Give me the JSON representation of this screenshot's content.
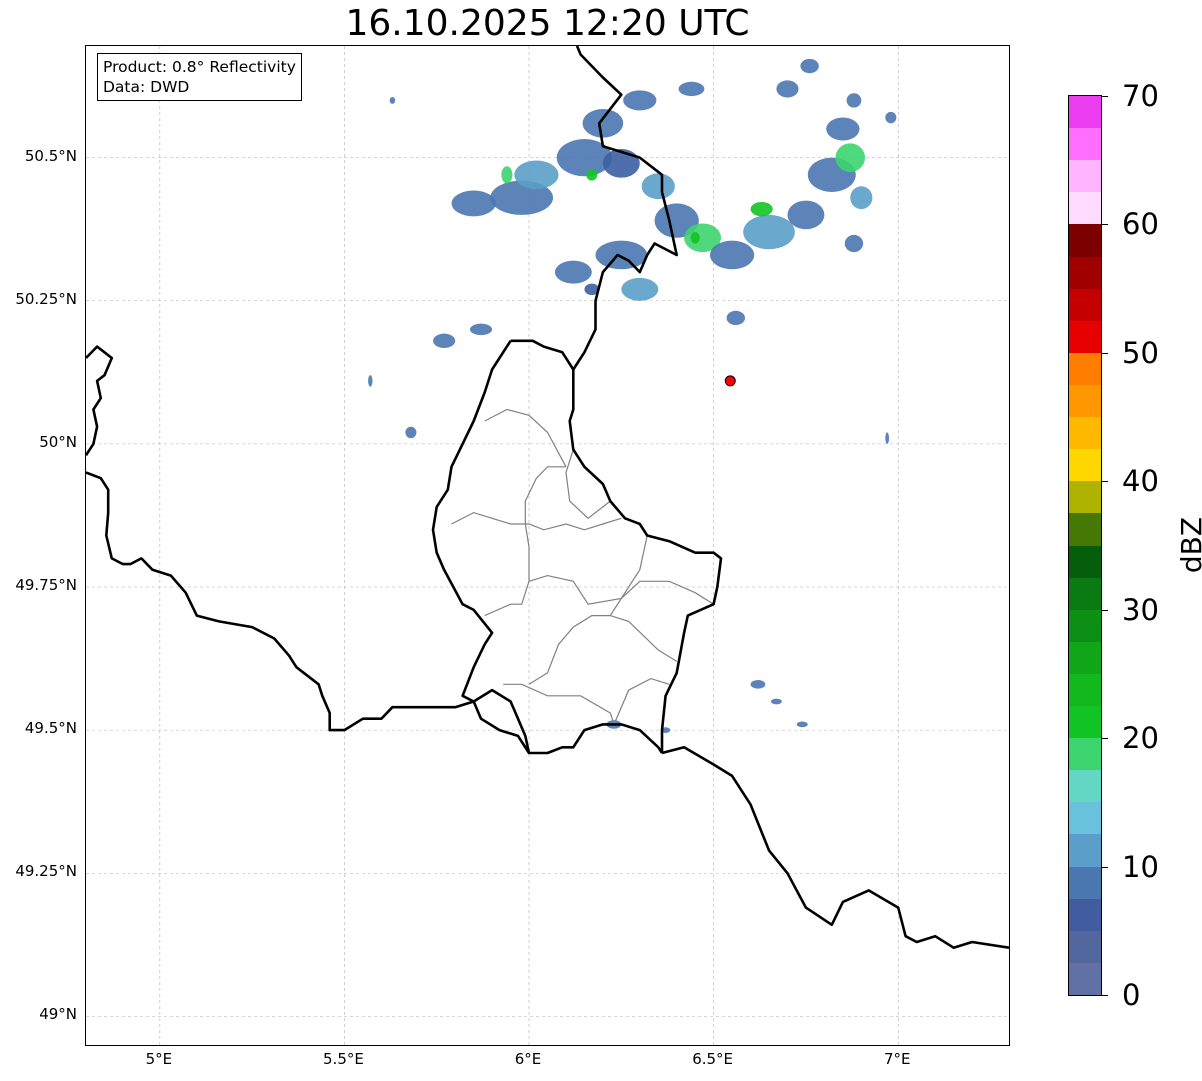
{
  "title": "16.10.2025 12:20 UTC",
  "info": {
    "product": "Product: 0.8° Reflectivity",
    "data": "Data: DWD"
  },
  "map": {
    "lon_range": [
      4.8,
      7.3
    ],
    "lat_range": [
      48.95,
      50.695
    ],
    "lat_ticks": [
      {
        "value": 49.0,
        "label": "49°N"
      },
      {
        "value": 49.25,
        "label": "49.25°N"
      },
      {
        "value": 49.5,
        "label": "49.5°N"
      },
      {
        "value": 49.75,
        "label": "49.75°N"
      },
      {
        "value": 50.0,
        "label": "50°N"
      },
      {
        "value": 50.25,
        "label": "50.25°N"
      },
      {
        "value": 50.5,
        "label": "50.5°N"
      }
    ],
    "lon_ticks": [
      {
        "value": 5.0,
        "label": "5°E"
      },
      {
        "value": 5.5,
        "label": "5.5°E"
      },
      {
        "value": 6.0,
        "label": "6°E"
      },
      {
        "value": 6.5,
        "label": "6.5°E"
      },
      {
        "value": 7.0,
        "label": "7°E"
      }
    ],
    "grid": true,
    "marker": {
      "lon": 6.545,
      "lat": 50.11,
      "color": "#ff0000"
    },
    "borders": [
      [
        [
          4.8,
          50.15
        ],
        [
          4.83,
          50.17
        ],
        [
          4.85,
          50.16
        ],
        [
          4.87,
          50.15
        ],
        [
          4.85,
          50.12
        ],
        [
          4.83,
          50.11
        ],
        [
          4.84,
          50.08
        ],
        [
          4.82,
          50.06
        ],
        [
          4.83,
          50.03
        ],
        [
          4.82,
          50.0
        ],
        [
          4.8,
          49.98
        ]
      ],
      [
        [
          4.8,
          49.95
        ],
        [
          4.84,
          49.94
        ],
        [
          4.86,
          49.92
        ],
        [
          4.86,
          49.88
        ],
        [
          4.855,
          49.84
        ],
        [
          4.87,
          49.8
        ],
        [
          4.9,
          49.79
        ],
        [
          4.92,
          49.79
        ],
        [
          4.95,
          49.8
        ],
        [
          4.98,
          49.78
        ],
        [
          5.03,
          49.77
        ],
        [
          5.07,
          49.74
        ],
        [
          5.1,
          49.7
        ],
        [
          5.16,
          49.69
        ],
        [
          5.25,
          49.68
        ],
        [
          5.31,
          49.66
        ],
        [
          5.35,
          49.63
        ],
        [
          5.37,
          49.61
        ],
        [
          5.43,
          49.58
        ],
        [
          5.44,
          49.56
        ],
        [
          5.46,
          49.53
        ],
        [
          5.46,
          49.5
        ],
        [
          5.5,
          49.5
        ],
        [
          5.55,
          49.52
        ],
        [
          5.6,
          49.52
        ],
        [
          5.63,
          49.54
        ],
        [
          5.7,
          49.54
        ],
        [
          5.8,
          49.54
        ],
        [
          5.85,
          49.55
        ],
        [
          5.9,
          49.57
        ],
        [
          5.95,
          49.55
        ],
        [
          5.97,
          49.52
        ],
        [
          5.99,
          49.49
        ],
        [
          6.0,
          49.46
        ],
        [
          6.05,
          49.46
        ],
        [
          6.09,
          49.47
        ],
        [
          6.12,
          49.47
        ],
        [
          6.15,
          49.5
        ],
        [
          6.2,
          49.51
        ],
        [
          6.25,
          49.51
        ],
        [
          6.3,
          49.5
        ],
        [
          6.35,
          49.47
        ],
        [
          6.36,
          49.46
        ]
      ],
      [
        [
          6.36,
          49.46
        ],
        [
          6.42,
          49.47
        ],
        [
          6.5,
          49.44
        ],
        [
          6.55,
          49.42
        ],
        [
          6.6,
          49.37
        ],
        [
          6.65,
          49.29
        ],
        [
          6.7,
          49.25
        ],
        [
          6.75,
          49.19
        ],
        [
          6.82,
          49.16
        ],
        [
          6.85,
          49.2
        ],
        [
          6.92,
          49.22
        ],
        [
          7.0,
          49.19
        ],
        [
          7.02,
          49.14
        ],
        [
          7.05,
          49.13
        ],
        [
          7.1,
          49.14
        ],
        [
          7.15,
          49.12
        ],
        [
          7.2,
          49.13
        ],
        [
          7.3,
          49.12
        ]
      ],
      [
        [
          5.95,
          50.18
        ],
        [
          6.01,
          50.18
        ],
        [
          6.04,
          50.17
        ],
        [
          6.09,
          50.16
        ],
        [
          6.12,
          50.13
        ],
        [
          6.12,
          50.09
        ],
        [
          6.12,
          50.06
        ],
        [
          6.11,
          50.04
        ],
        [
          6.12,
          49.99
        ],
        [
          6.15,
          49.96
        ],
        [
          6.2,
          49.93
        ],
        [
          6.22,
          49.9
        ],
        [
          6.26,
          49.87
        ],
        [
          6.3,
          49.86
        ],
        [
          6.32,
          49.84
        ],
        [
          6.38,
          49.83
        ],
        [
          6.45,
          49.81
        ],
        [
          6.5,
          49.81
        ],
        [
          6.52,
          49.8
        ],
        [
          6.51,
          49.75
        ],
        [
          6.5,
          49.72
        ],
        [
          6.43,
          49.7
        ],
        [
          6.42,
          49.67
        ],
        [
          6.4,
          49.6
        ],
        [
          6.37,
          49.56
        ],
        [
          6.36,
          49.5
        ],
        [
          6.36,
          49.46
        ]
      ],
      [
        [
          6.0,
          49.46
        ],
        [
          5.97,
          49.49
        ],
        [
          5.92,
          49.5
        ],
        [
          5.87,
          49.52
        ],
        [
          5.85,
          49.55
        ],
        [
          5.82,
          49.56
        ],
        [
          5.85,
          49.61
        ],
        [
          5.88,
          49.65
        ],
        [
          5.9,
          49.67
        ],
        [
          5.85,
          49.71
        ],
        [
          5.82,
          49.72
        ],
        [
          5.77,
          49.78
        ],
        [
          5.75,
          49.81
        ],
        [
          5.74,
          49.85
        ],
        [
          5.75,
          49.89
        ],
        [
          5.78,
          49.92
        ],
        [
          5.79,
          49.96
        ],
        [
          5.82,
          50.0
        ],
        [
          5.85,
          50.04
        ],
        [
          5.88,
          50.09
        ],
        [
          5.9,
          50.13
        ],
        [
          5.95,
          50.18
        ]
      ],
      [
        [
          6.12,
          50.13
        ],
        [
          6.15,
          50.16
        ],
        [
          6.18,
          50.2
        ],
        [
          6.18,
          50.25
        ],
        [
          6.2,
          50.3
        ],
        [
          6.24,
          50.33
        ],
        [
          6.27,
          50.32
        ],
        [
          6.3,
          50.3
        ],
        [
          6.32,
          50.33
        ],
        [
          6.34,
          50.35
        ],
        [
          6.4,
          50.33
        ],
        [
          6.38,
          50.39
        ],
        [
          6.36,
          50.44
        ],
        [
          6.36,
          50.47
        ],
        [
          6.3,
          50.5
        ],
        [
          6.2,
          50.52
        ],
        [
          6.19,
          50.56
        ],
        [
          6.25,
          50.61
        ],
        [
          6.2,
          50.64
        ],
        [
          6.14,
          50.68
        ],
        [
          6.13,
          50.695
        ]
      ]
    ],
    "admin": [
      [
        [
          6.23,
          49.51
        ],
        [
          6.22,
          49.53
        ],
        [
          6.14,
          49.56
        ],
        [
          6.05,
          49.56
        ],
        [
          5.98,
          49.58
        ],
        [
          5.93,
          49.58
        ]
      ],
      [
        [
          6.23,
          49.51
        ],
        [
          6.27,
          49.57
        ],
        [
          6.33,
          49.59
        ],
        [
          6.38,
          49.58
        ]
      ],
      [
        [
          6.0,
          49.58
        ],
        [
          6.05,
          49.6
        ],
        [
          6.08,
          49.65
        ],
        [
          6.12,
          49.68
        ],
        [
          6.17,
          49.7
        ],
        [
          6.22,
          49.7
        ],
        [
          6.27,
          49.69
        ],
        [
          6.35,
          49.64
        ],
        [
          6.4,
          49.62
        ]
      ],
      [
        [
          5.88,
          49.7
        ],
        [
          5.95,
          49.72
        ],
        [
          5.98,
          49.72
        ],
        [
          6.0,
          49.76
        ],
        [
          6.0,
          49.82
        ],
        [
          5.99,
          49.86
        ],
        [
          5.99,
          49.9
        ],
        [
          6.02,
          49.94
        ],
        [
          6.05,
          49.96
        ],
        [
          6.1,
          49.96
        ]
      ],
      [
        [
          5.79,
          49.86
        ],
        [
          5.85,
          49.88
        ],
        [
          5.9,
          49.87
        ],
        [
          5.95,
          49.86
        ],
        [
          6.0,
          49.86
        ],
        [
          6.04,
          49.85
        ],
        [
          6.1,
          49.86
        ],
        [
          6.15,
          49.85
        ],
        [
          6.2,
          49.86
        ],
        [
          6.25,
          49.87
        ]
      ],
      [
        [
          6.0,
          49.76
        ],
        [
          6.05,
          49.77
        ],
        [
          6.12,
          49.76
        ],
        [
          6.16,
          49.72
        ],
        [
          6.25,
          49.73
        ],
        [
          6.3,
          49.76
        ],
        [
          6.38,
          49.76
        ],
        [
          6.45,
          49.74
        ],
        [
          6.5,
          49.72
        ]
      ],
      [
        [
          6.1,
          49.96
        ],
        [
          6.05,
          50.02
        ],
        [
          6.0,
          50.05
        ],
        [
          5.94,
          50.06
        ],
        [
          5.88,
          50.04
        ]
      ],
      [
        [
          6.12,
          49.99
        ],
        [
          6.1,
          49.95
        ],
        [
          6.11,
          49.9
        ],
        [
          6.16,
          49.87
        ],
        [
          6.22,
          49.9
        ]
      ],
      [
        [
          6.22,
          49.7
        ],
        [
          6.26,
          49.74
        ],
        [
          6.3,
          49.78
        ],
        [
          6.32,
          49.84
        ]
      ]
    ],
    "echoes": [
      {
        "lon": 5.85,
        "lat": 50.42,
        "w": 0.12,
        "h": 0.045,
        "c": "#4b77b0"
      },
      {
        "lon": 5.98,
        "lat": 50.43,
        "w": 0.17,
        "h": 0.06,
        "c": "#4b77b0"
      },
      {
        "lon": 6.02,
        "lat": 50.47,
        "w": 0.12,
        "h": 0.05,
        "c": "#5b9ec9"
      },
      {
        "lon": 6.15,
        "lat": 50.5,
        "w": 0.15,
        "h": 0.065,
        "c": "#4b77b0"
      },
      {
        "lon": 6.25,
        "lat": 50.49,
        "w": 0.1,
        "h": 0.05,
        "c": "#3c5fa3"
      },
      {
        "lon": 6.2,
        "lat": 50.56,
        "w": 0.11,
        "h": 0.05,
        "c": "#4b77b0"
      },
      {
        "lon": 6.3,
        "lat": 50.6,
        "w": 0.09,
        "h": 0.035,
        "c": "#4b77b0"
      },
      {
        "lon": 6.35,
        "lat": 50.45,
        "w": 0.09,
        "h": 0.045,
        "c": "#5b9ec9"
      },
      {
        "lon": 6.12,
        "lat": 50.3,
        "w": 0.1,
        "h": 0.04,
        "c": "#4b77b0"
      },
      {
        "lon": 6.25,
        "lat": 50.33,
        "w": 0.14,
        "h": 0.05,
        "c": "#4b77b0"
      },
      {
        "lon": 6.3,
        "lat": 50.27,
        "w": 0.1,
        "h": 0.04,
        "c": "#5b9ec9"
      },
      {
        "lon": 6.4,
        "lat": 50.39,
        "w": 0.12,
        "h": 0.06,
        "c": "#4b77b0"
      },
      {
        "lon": 6.47,
        "lat": 50.36,
        "w": 0.1,
        "h": 0.05,
        "c": "#3cd46e"
      },
      {
        "lon": 6.55,
        "lat": 50.33,
        "w": 0.12,
        "h": 0.05,
        "c": "#4b77b0"
      },
      {
        "lon": 6.65,
        "lat": 50.37,
        "w": 0.14,
        "h": 0.06,
        "c": "#5b9ec9"
      },
      {
        "lon": 6.63,
        "lat": 50.41,
        "w": 0.06,
        "h": 0.025,
        "c": "#12c423"
      },
      {
        "lon": 6.75,
        "lat": 50.4,
        "w": 0.1,
        "h": 0.05,
        "c": "#4b77b0"
      },
      {
        "lon": 6.82,
        "lat": 50.47,
        "w": 0.13,
        "h": 0.06,
        "c": "#4b77b0"
      },
      {
        "lon": 6.87,
        "lat": 50.5,
        "w": 0.08,
        "h": 0.05,
        "c": "#3cd46e"
      },
      {
        "lon": 6.85,
        "lat": 50.55,
        "w": 0.09,
        "h": 0.04,
        "c": "#4b77b0"
      },
      {
        "lon": 6.9,
        "lat": 50.43,
        "w": 0.06,
        "h": 0.04,
        "c": "#5b9ec9"
      },
      {
        "lon": 6.88,
        "lat": 50.35,
        "w": 0.05,
        "h": 0.03,
        "c": "#4b77b0"
      },
      {
        "lon": 6.7,
        "lat": 50.62,
        "w": 0.06,
        "h": 0.03,
        "c": "#4b77b0"
      },
      {
        "lon": 6.76,
        "lat": 50.66,
        "w": 0.05,
        "h": 0.025,
        "c": "#4b77b0"
      },
      {
        "lon": 6.88,
        "lat": 50.6,
        "w": 0.04,
        "h": 0.025,
        "c": "#4b77b0"
      },
      {
        "lon": 6.98,
        "lat": 50.57,
        "w": 0.03,
        "h": 0.02,
        "c": "#4b77b0"
      },
      {
        "lon": 6.56,
        "lat": 50.22,
        "w": 0.05,
        "h": 0.025,
        "c": "#4b77b0"
      },
      {
        "lon": 6.44,
        "lat": 50.62,
        "w": 0.07,
        "h": 0.025,
        "c": "#4b77b0"
      },
      {
        "lon": 5.77,
        "lat": 50.18,
        "w": 0.06,
        "h": 0.025,
        "c": "#4b77b0"
      },
      {
        "lon": 5.87,
        "lat": 50.2,
        "w": 0.06,
        "h": 0.02,
        "c": "#4b77b0"
      },
      {
        "lon": 5.68,
        "lat": 50.02,
        "w": 0.03,
        "h": 0.02,
        "c": "#4b77b0"
      },
      {
        "lon": 5.57,
        "lat": 50.11,
        "w": 0.012,
        "h": 0.02,
        "c": "#4b77b0"
      },
      {
        "lon": 5.63,
        "lat": 50.6,
        "w": 0.015,
        "h": 0.012,
        "c": "#4b77b0"
      },
      {
        "lon": 6.62,
        "lat": 49.58,
        "w": 0.04,
        "h": 0.015,
        "c": "#4b77b0"
      },
      {
        "lon": 6.67,
        "lat": 49.55,
        "w": 0.03,
        "h": 0.01,
        "c": "#4b77b0"
      },
      {
        "lon": 6.74,
        "lat": 49.51,
        "w": 0.03,
        "h": 0.01,
        "c": "#4b77b0"
      },
      {
        "lon": 6.23,
        "lat": 49.51,
        "w": 0.04,
        "h": 0.015,
        "c": "#4b77b0"
      },
      {
        "lon": 6.37,
        "lat": 49.5,
        "w": 0.025,
        "h": 0.01,
        "c": "#4b77b0"
      },
      {
        "lon": 6.97,
        "lat": 50.01,
        "w": 0.01,
        "h": 0.02,
        "c": "#4b77b0"
      },
      {
        "lon": 6.17,
        "lat": 50.27,
        "w": 0.04,
        "h": 0.02,
        "c": "#3c5fa3"
      },
      {
        "lon": 5.94,
        "lat": 50.47,
        "w": 0.03,
        "h": 0.03,
        "c": "#3cd46e"
      },
      {
        "lon": 6.17,
        "lat": 50.47,
        "w": 0.03,
        "h": 0.02,
        "c": "#12c423"
      },
      {
        "lon": 6.45,
        "lat": 50.36,
        "w": 0.025,
        "h": 0.02,
        "c": "#12c423"
      }
    ]
  },
  "colorbar": {
    "label": "dBZ",
    "min": 0,
    "max": 70,
    "step": 2.5,
    "ticks": [
      {
        "value": 0,
        "label": "0"
      },
      {
        "value": 10,
        "label": "10"
      },
      {
        "value": 20,
        "label": "20"
      },
      {
        "value": 30,
        "label": "30"
      },
      {
        "value": 40,
        "label": "40"
      },
      {
        "value": 50,
        "label": "50"
      },
      {
        "value": 60,
        "label": "60"
      },
      {
        "value": 70,
        "label": "70"
      }
    ],
    "colors": [
      "#6171a6",
      "#52679e",
      "#415c9f",
      "#4b77b0",
      "#5b9ec9",
      "#68c2dc",
      "#64d6c4",
      "#3cd46e",
      "#12c423",
      "#12b81e",
      "#10a618",
      "#0c8f14",
      "#0a7b12",
      "#065e0c",
      "#467806",
      "#b0b200",
      "#ffd700",
      "#ffb800",
      "#ff9800",
      "#ff7e00",
      "#e60000",
      "#c40000",
      "#a00000",
      "#7c0000",
      "#ffdcff",
      "#ffb4ff",
      "#ff6eff",
      "#eb3cf0"
    ]
  }
}
